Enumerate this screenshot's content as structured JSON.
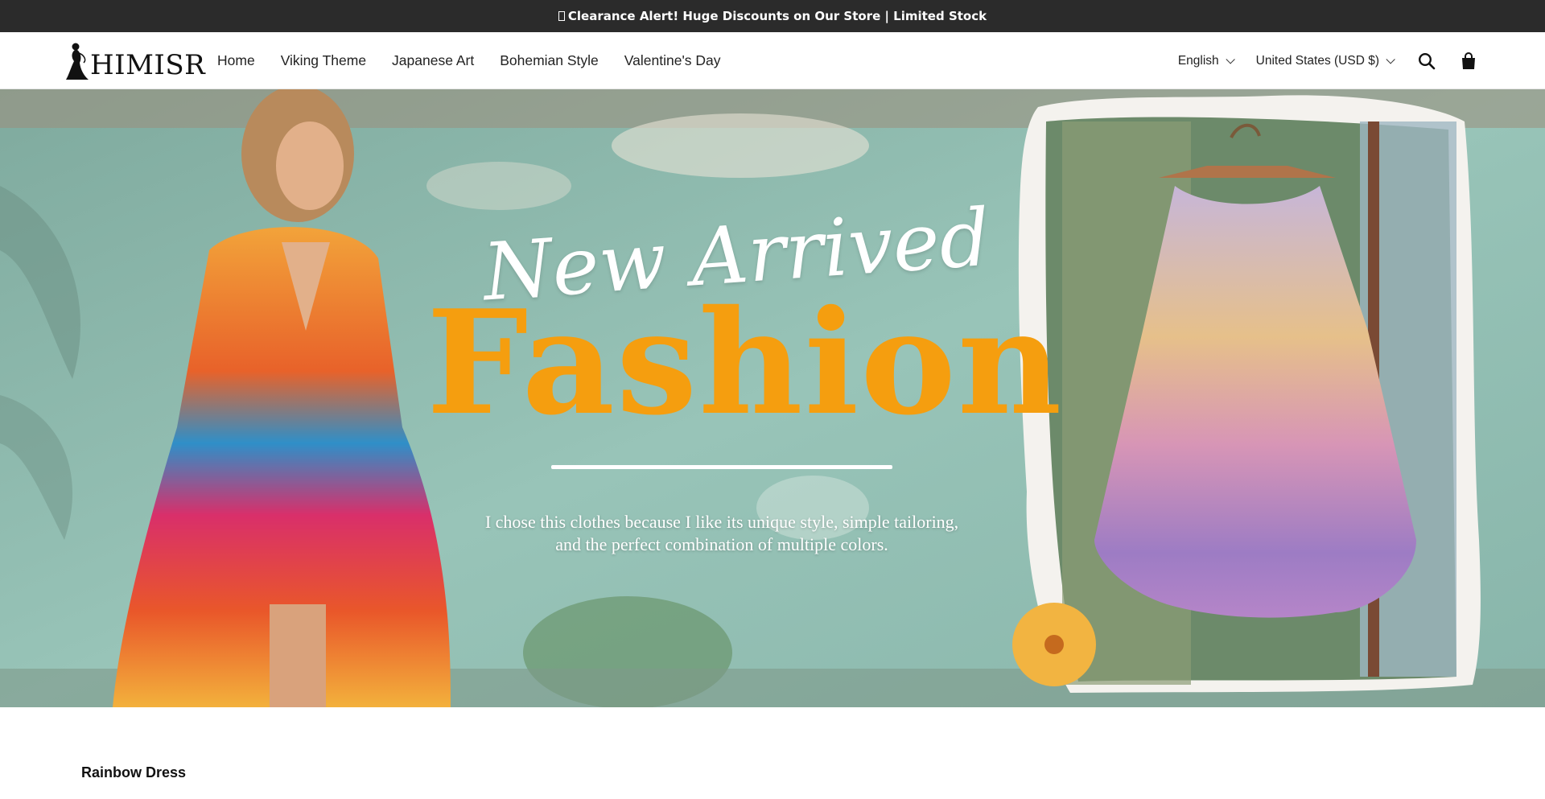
{
  "announcement": {
    "text": "Clearance Alert! Huge Discounts on Our Store | Limited Stock"
  },
  "header": {
    "logo_text": "HIMISR",
    "nav": [
      {
        "label": "Home"
      },
      {
        "label": "Viking Theme"
      },
      {
        "label": "Japanese Art"
      },
      {
        "label": "Bohemian Style"
      },
      {
        "label": "Valentine's Day"
      }
    ],
    "language": "English",
    "currency": "United States (USD $)",
    "icons": {
      "search": "search-icon",
      "cart": "shopping-bag-icon",
      "logo": "woman-silhouette-icon"
    }
  },
  "hero": {
    "script_text": "New Arrived",
    "title": "Fashion",
    "subtitle_line1": "I chose this clothes because I like its unique style, simple tailoring,",
    "subtitle_line2": "and the perfect combination of multiple colors.",
    "colors": {
      "title": "#f59e0f",
      "wall": "#8fbcb0"
    }
  },
  "section": {
    "title": "Rainbow Dress"
  }
}
